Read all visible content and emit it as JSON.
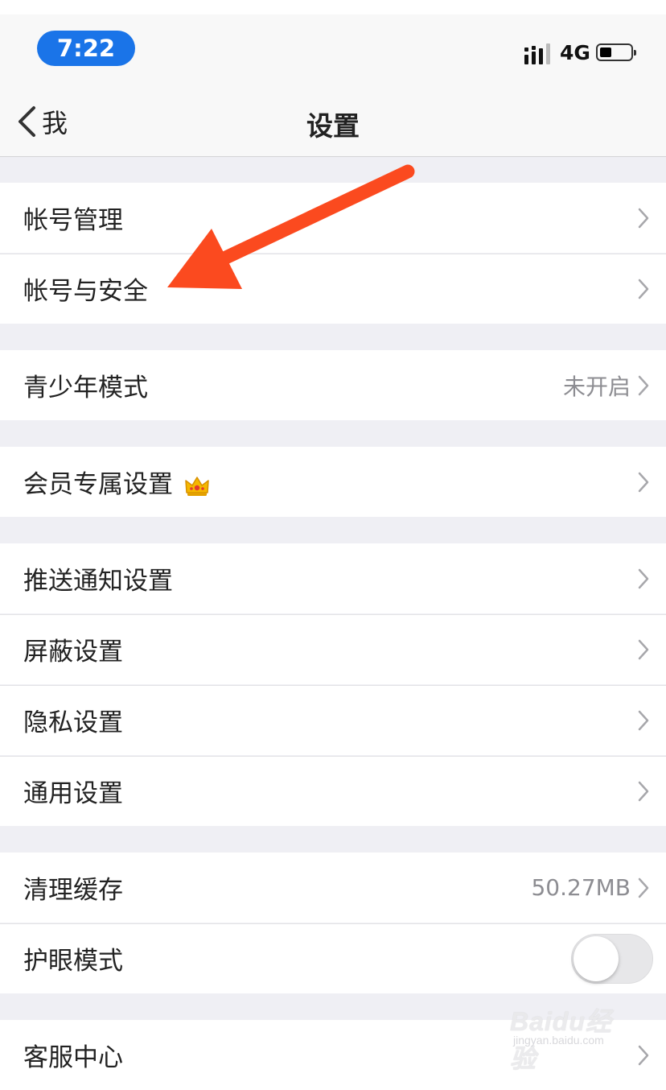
{
  "status_bar": {
    "time": "7:22",
    "network": "4G",
    "time_pill_color": "#1a74e8"
  },
  "nav": {
    "back_label": "我",
    "title": "设置"
  },
  "rows": [
    {
      "label": "帐号管理",
      "value": "",
      "accessory": "chevron"
    },
    {
      "label": "帐号与安全",
      "value": "",
      "accessory": "chevron"
    },
    {
      "label": "青少年模式",
      "value": "未开启",
      "accessory": "chevron"
    },
    {
      "label": "会员专属设置",
      "value": "",
      "accessory": "chevron",
      "badge_icon": "crown-icon"
    },
    {
      "label": "推送通知设置",
      "value": "",
      "accessory": "chevron"
    },
    {
      "label": "屏蔽设置",
      "value": "",
      "accessory": "chevron"
    },
    {
      "label": "隐私设置",
      "value": "",
      "accessory": "chevron"
    },
    {
      "label": "通用设置",
      "value": "",
      "accessory": "chevron"
    },
    {
      "label": "清理缓存",
      "value": "50.27MB",
      "accessory": "chevron"
    },
    {
      "label": "护眼模式",
      "value": "",
      "accessory": "toggle",
      "toggle_on": false
    },
    {
      "label": "客服中心",
      "value": "",
      "accessory": "chevron"
    }
  ],
  "annotation": {
    "arrow_color": "#fb4a1f"
  },
  "watermark": {
    "brand": "Baidu经验",
    "url": "jingyan.baidu.com"
  }
}
